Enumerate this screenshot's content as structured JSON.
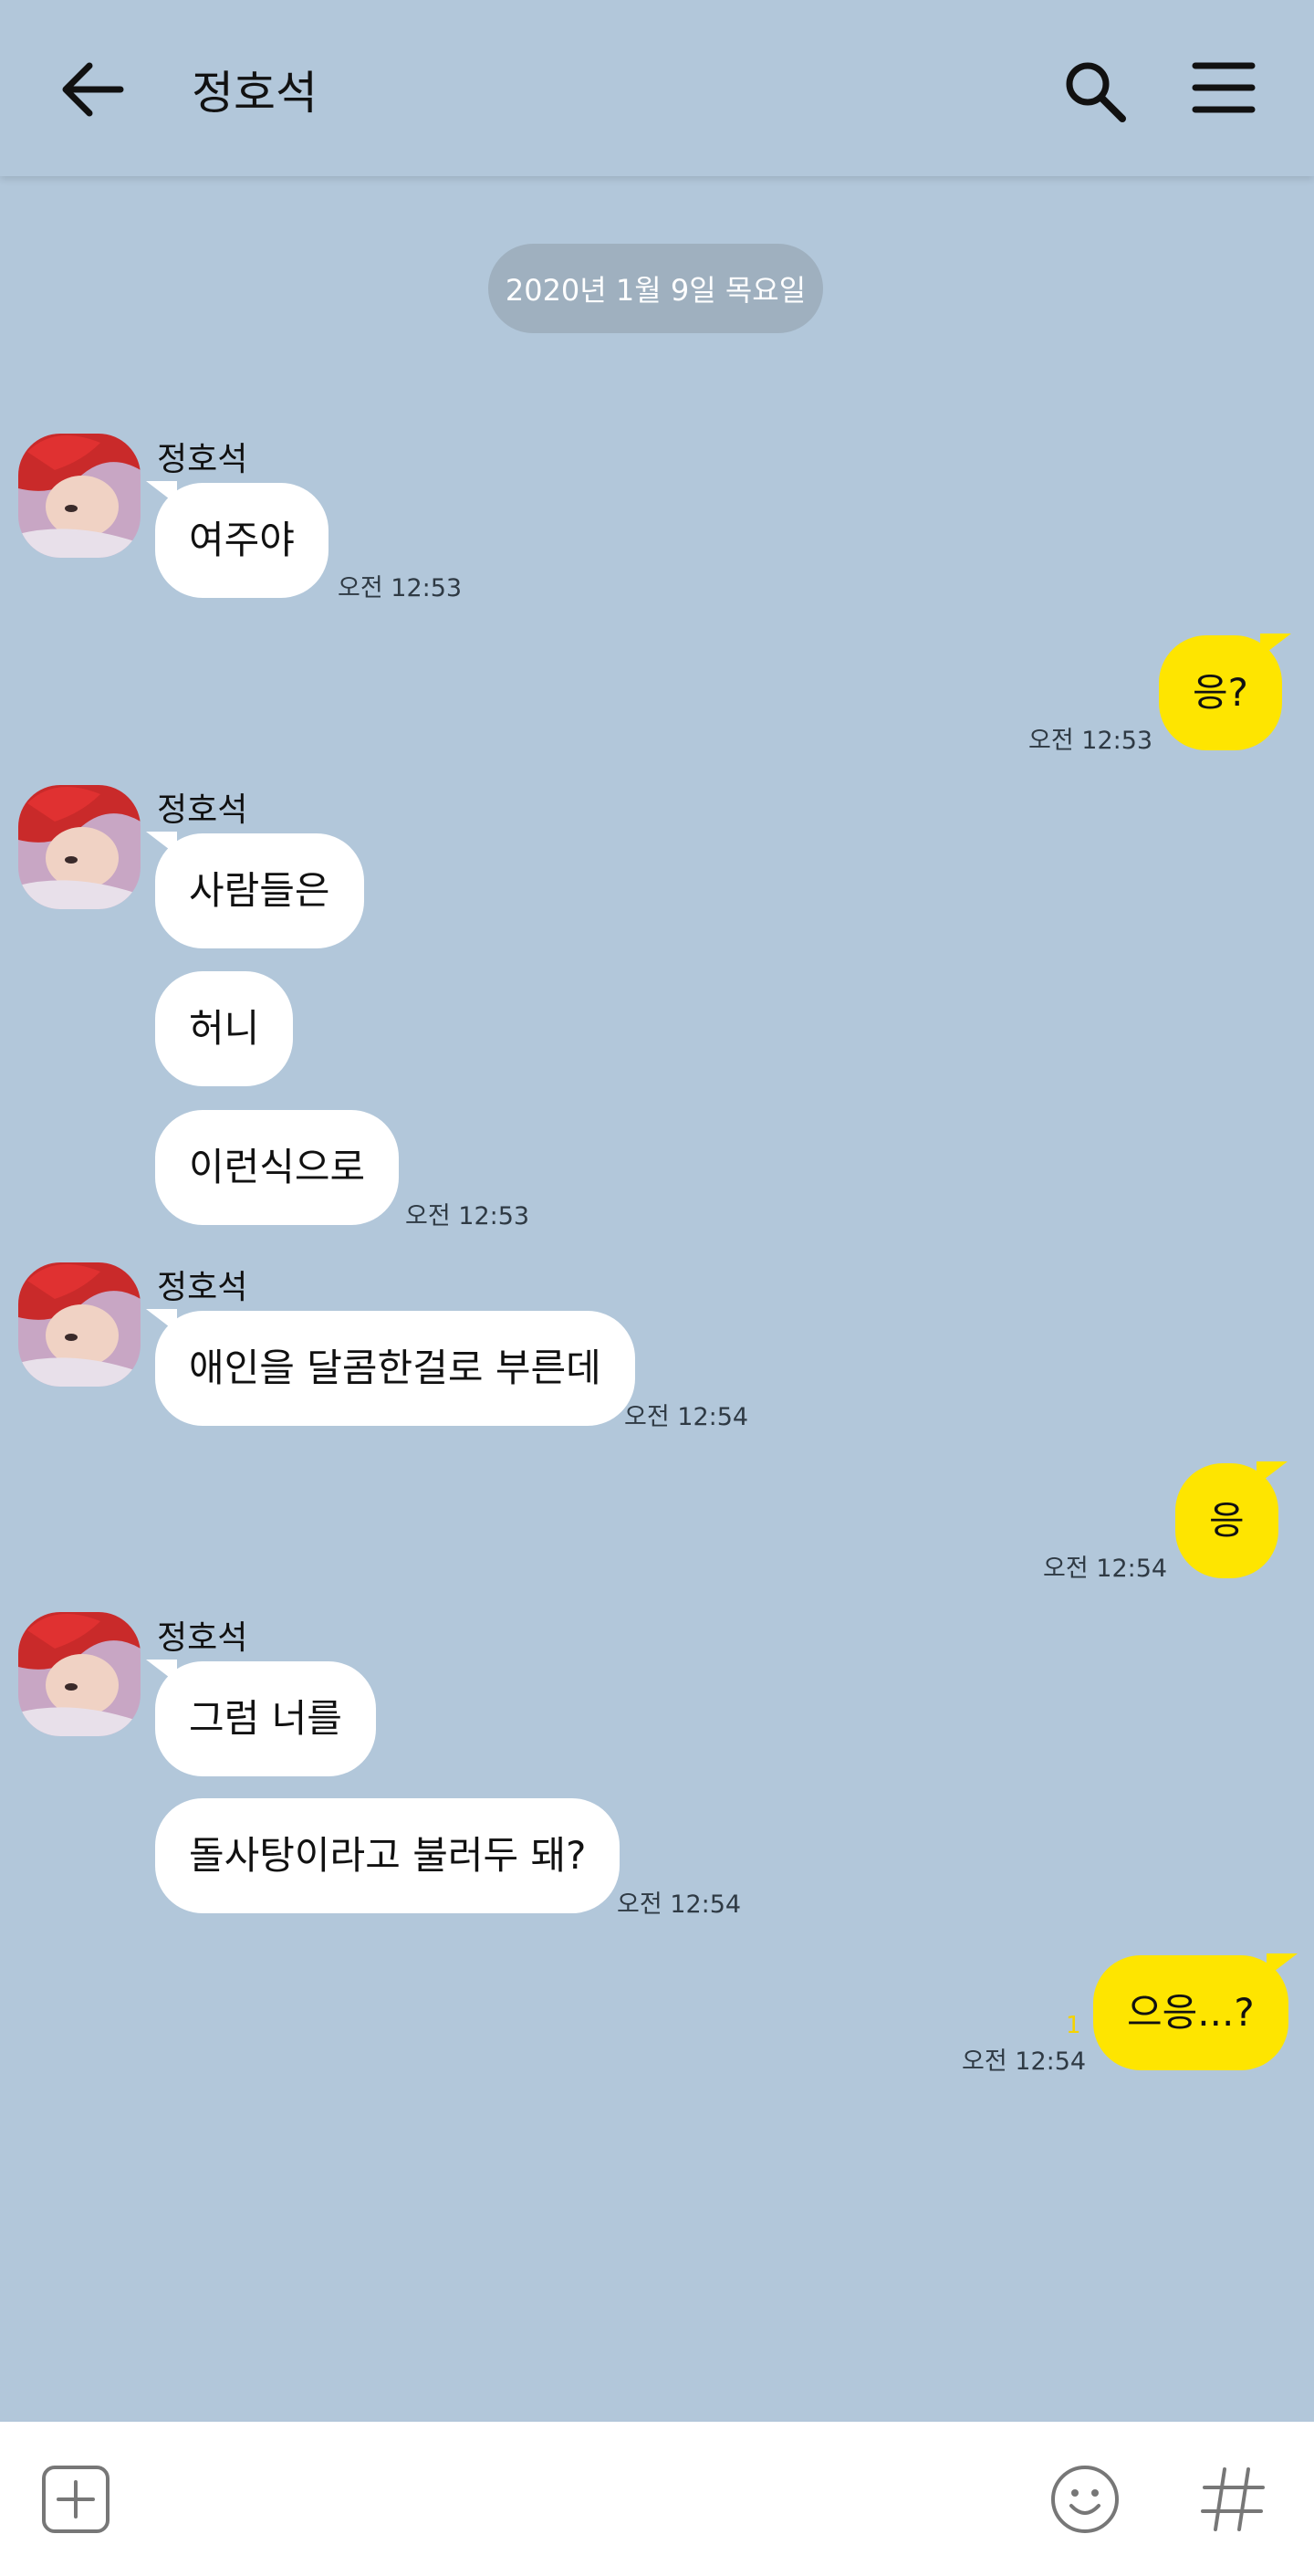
{
  "header": {
    "back_icon": "arrow-left-icon",
    "title": "정호석",
    "search_icon": "search-icon",
    "menu_icon": "hamburger-menu-icon"
  },
  "date_divider": "2020년 1월 9일 목요일",
  "messages": [
    {
      "from": "정호석",
      "text": "여주야",
      "time": "오전 12:53"
    },
    {
      "from": "me",
      "text": "응?",
      "time": "오전 12:53"
    },
    {
      "from": "정호석",
      "text": "사람들은"
    },
    {
      "from": "정호석",
      "text": "허니"
    },
    {
      "from": "정호석",
      "text": "이런식으로",
      "time": "오전 12:53"
    },
    {
      "from": "정호석",
      "text": "애인을 달콤한걸로 부른데",
      "time": "오전 12:54"
    },
    {
      "from": "me",
      "text": "응",
      "time": "오전 12:54"
    },
    {
      "from": "정호석",
      "text": "그럼 너를"
    },
    {
      "from": "정호석",
      "text": "돌사탕이라고 불러두 돼?",
      "time": "오전 12:54"
    },
    {
      "from": "me",
      "text": "으응...?",
      "time": "오전 12:54",
      "unread": "1"
    }
  ],
  "input_bar": {
    "add_icon": "plus-square-icon",
    "emoji_icon": "emoji-smile-icon",
    "hashtag_icon": "hashtag-icon"
  },
  "colors": {
    "background": "#b2c7da",
    "outgoing_bubble": "#fee500",
    "incoming_bubble": "#ffffff",
    "date_pill": "#9fb0bf"
  }
}
